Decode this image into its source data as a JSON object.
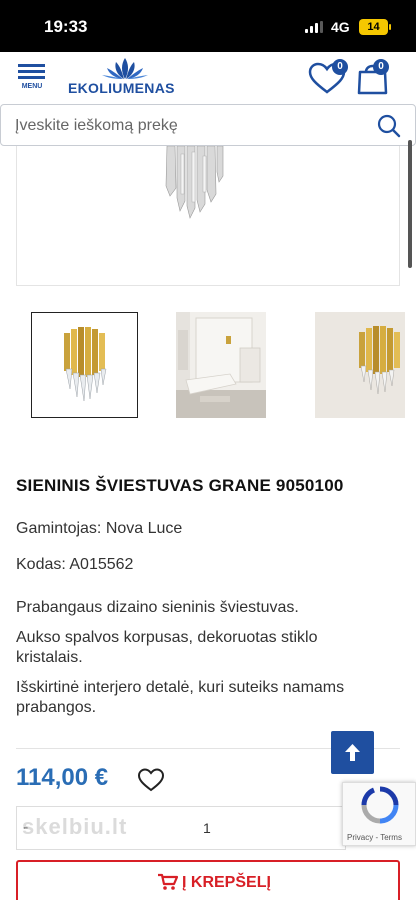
{
  "status_bar": {
    "time": "19:33",
    "network": "4G",
    "battery": "14"
  },
  "header": {
    "menu_label": "MENU",
    "logo_text": "EKOLIUMENAS",
    "wishlist_count": "0",
    "cart_count": "0"
  },
  "search": {
    "placeholder": "Įveskite ieškomą prekę"
  },
  "product": {
    "title": "SIENINIS ŠVIESTUVAS GRANE 9050100",
    "manufacturer": "Gamintojas: Nova Luce",
    "code": "Kodas: A015562",
    "description": [
      "Prabangaus dizaino sieninis šviestuvas.",
      "Aukso spalvos korpusas, dekoruotas stiklo kristalais.",
      "Išskirtinė interjero detalė, kuri suteiks namams prabangos."
    ],
    "price": "114,00 €",
    "quantity_minus": "-",
    "quantity": "1",
    "add_to_cart": "Į KREPŠELĮ"
  },
  "watermark": "skelbiu.lt",
  "recaptcha": {
    "links": "Privacy - Terms"
  },
  "colors": {
    "brand_blue": "#1f4fa0",
    "price_blue": "#2a6db5",
    "cta_red": "#d81f26",
    "gold": "#c9a23c"
  }
}
